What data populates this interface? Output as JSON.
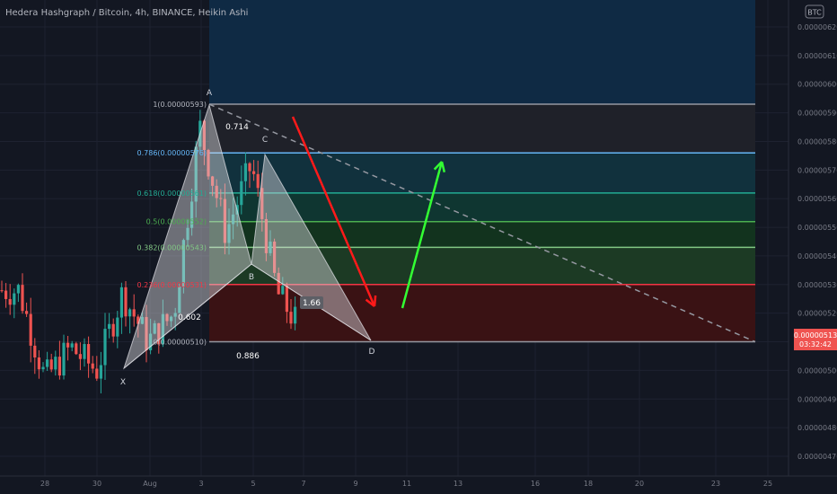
{
  "header": {
    "title": "Hedera Hashgraph / Bitcoin, 4h, BINANCE, Heikin Ashi",
    "currency_badge": "BTC"
  },
  "colors": {
    "background": "#131722",
    "grid": "#1e2230",
    "axis_text": "#787b86",
    "candle_up": "#26a69a",
    "candle_down": "#ef5350",
    "price_badge": "#ef5350",
    "arrow_down": "#ff1a1a",
    "arrow_up": "#33ff33"
  },
  "chart_data": {
    "type": "candlestick",
    "title": "Hedera Hashgraph / Bitcoin, 4h, BINANCE, Heikin Ashi",
    "x_tick_labels": [
      "28",
      "30",
      "Aug",
      "3",
      "5",
      "7",
      "9",
      "11",
      "13",
      "16",
      "18",
      "20",
      "23",
      "25"
    ],
    "y_ticks": [
      "0.00000620",
      "0.00000610",
      "0.00000600",
      "0.00000590",
      "0.00000580",
      "0.00000570",
      "0.00000560",
      "0.00000550",
      "0.00000540",
      "0.00000530",
      "0.00000520",
      "0.00000510",
      "0.00000500",
      "0.00000490",
      "0.00000480",
      "0.00000470"
    ],
    "ylim": [
      4.65e-06,
      6.25e-06
    ],
    "current_price": {
      "value": "0.00000513",
      "countdown": "03:32:42"
    },
    "candles_approx": {
      "note_price_path": [
        [
          "27",
          5.28e-06
        ],
        [
          "28",
          4.97e-06
        ],
        [
          "29",
          5.08e-06
        ],
        [
          "30",
          5e-06
        ],
        [
          "31",
          5.27e-06
        ],
        [
          "Aug 1",
          5.1e-06
        ],
        [
          "Aug 2",
          5.2e-06
        ],
        [
          "Aug 3",
          5.85e-06
        ],
        [
          "Aug 4",
          5.48e-06
        ],
        [
          "Aug 5",
          5.72e-06
        ],
        [
          "Aug 6",
          5.27e-06
        ],
        [
          "Aug 7",
          5.13e-06
        ]
      ]
    },
    "fib_levels": [
      {
        "label": "1(0.00000593)",
        "price": 5.93e-06,
        "line_color": "#9598a1",
        "label_color": "#b2b5be"
      },
      {
        "label": "0.786(0.00000576)",
        "price": 5.76e-06,
        "line_color": "#64b5f6",
        "label_color": "#64b5f6"
      },
      {
        "label": "0.618(0.00000561)",
        "price": 5.62e-06,
        "line_color": "#22ab94",
        "label_color": "#22ab94"
      },
      {
        "label": "0.5(0.00000552)",
        "price": 5.52e-06,
        "line_color": "#4caf50",
        "label_color": "#4caf50"
      },
      {
        "label": "0.382(0.00000543)",
        "price": 5.43e-06,
        "line_color": "#81c784",
        "label_color": "#81c784"
      },
      {
        "label": "0.236(0.00000531)",
        "price": 5.3e-06,
        "line_color": "#f23645",
        "label_color": "#f23645"
      },
      {
        "label": "0(0.00000510)",
        "price": 5.1e-06,
        "line_color": "#9598a1",
        "label_color": "#b2b5be"
      }
    ],
    "harmonic_pattern": {
      "points": [
        {
          "name": "X",
          "x": "Jul 31",
          "y": 5e-06
        },
        {
          "name": "A",
          "x": "Aug 3",
          "y": 5.93e-06
        },
        {
          "name": "B",
          "x": "Aug 5",
          "y": 5.35e-06
        },
        {
          "name": "C",
          "x": "Aug 5",
          "y": 5.76e-06
        },
        {
          "name": "D",
          "x": "Aug 10",
          "y": 5.1e-06
        }
      ],
      "ratios": [
        "0.714",
        "0.602",
        "0.886",
        "1.66"
      ]
    }
  }
}
